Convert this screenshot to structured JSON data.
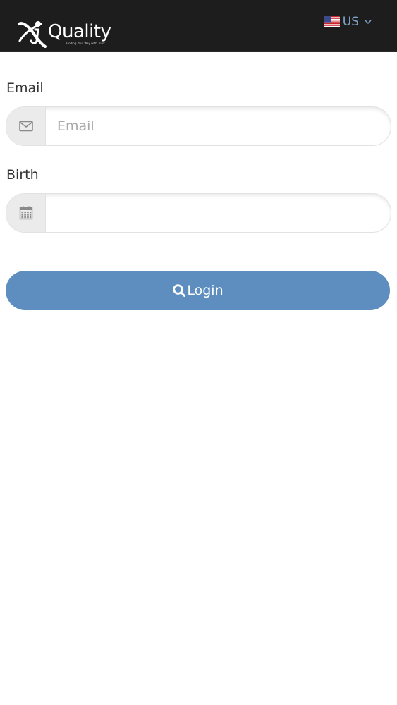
{
  "header": {
    "logo_text": "Quality",
    "logo_tagline": "Finding Your Way with Trust",
    "language": {
      "code": "US",
      "flag_icon": "us-flag-icon"
    },
    "background_color": "#1e1d1e"
  },
  "form": {
    "email": {
      "label": "Email",
      "placeholder": "Email",
      "value": "",
      "icon": "envelope-icon"
    },
    "birth": {
      "label": "Birth",
      "placeholder": "",
      "value": "",
      "icon": "calendar-icon"
    },
    "login_button": {
      "label": "Login",
      "icon": "search-icon",
      "color": "#5d8ebf"
    }
  }
}
